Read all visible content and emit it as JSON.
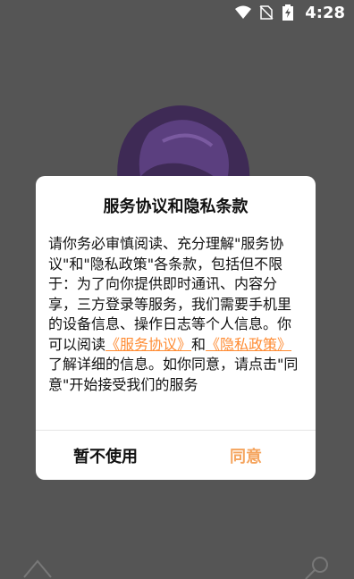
{
  "status": {
    "time": "4:28"
  },
  "dialog": {
    "title": "服务协议和隐私条款",
    "body_part1": "请你务必审慎阅读、充分理解\"服务协议\"和\"隐私政策\"各条款，包括但不限于：为了向你提供即时通讯、内容分享，三方登录等服务，我们需要手机里的设备信息、操作日志等个人信息。你可以阅读",
    "link_service": "《服务协议》",
    "body_and": "和",
    "link_privacy": "《隐私政策》",
    "body_part2": "了解详细的信息。如你同意，请点击\"同意\"开始接受我们的服务",
    "decline_label": "暂不使用",
    "agree_label": "同意"
  },
  "colors": {
    "accent": "#ff8c34",
    "agree": "#f5a45d",
    "overlay": "#555555"
  }
}
